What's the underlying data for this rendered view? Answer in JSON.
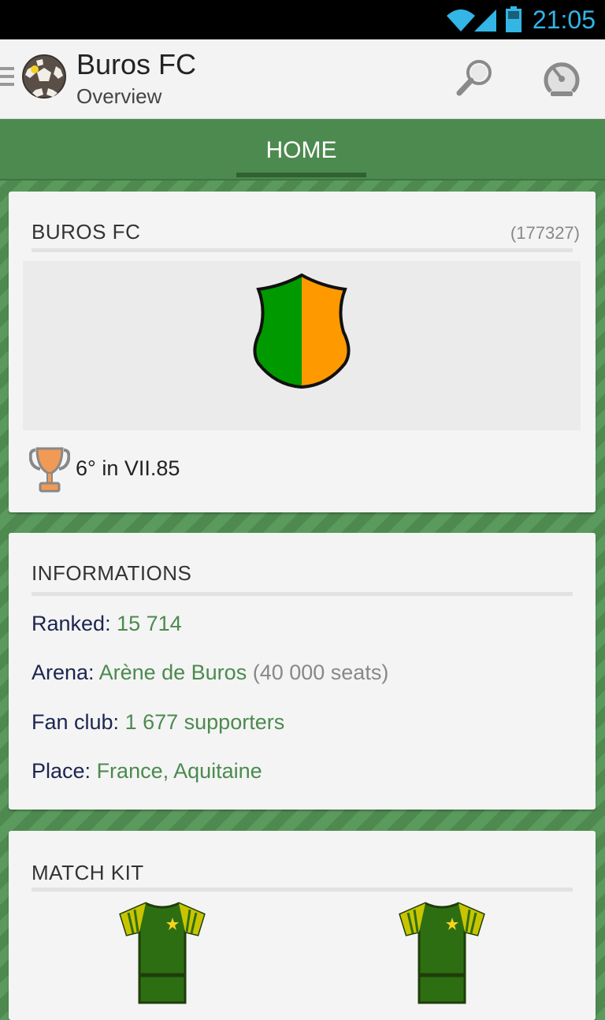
{
  "status_bar": {
    "time": "21:05",
    "icons": [
      "wifi-icon",
      "signal-icon",
      "battery-icon"
    ],
    "accent_color": "#33b5e5"
  },
  "action_bar": {
    "title": "Buros FC",
    "subtitle": "Overview",
    "icons": [
      "drawer-menu-icon",
      "club-logo-ball-icon",
      "search-icon",
      "speedometer-icon"
    ]
  },
  "tabs": [
    {
      "label": "HOME",
      "selected": true
    }
  ],
  "club_card": {
    "title": "BUROS FC",
    "id": "(177327)",
    "crest_colors": [
      "#009900",
      "#ff9900"
    ],
    "rank_text": "6° in VII.85"
  },
  "info_card": {
    "title": "INFORMATIONS",
    "rows": [
      {
        "label": "Ranked:",
        "value": "15 714",
        "extra": ""
      },
      {
        "label": "Arena:",
        "value": "Arène de Buros",
        "extra": "(40 000 seats)"
      },
      {
        "label": "Fan club:",
        "value": "1 677 supporters",
        "extra": ""
      },
      {
        "label": "Place:",
        "value": "France, Aquitaine",
        "extra": ""
      }
    ]
  },
  "kit_card": {
    "title": "MATCH KIT",
    "kits": [
      "home-kit",
      "away-kit"
    ],
    "kit_colors": {
      "shirt": "#2e6e12",
      "sleeves": "#d9d000",
      "star": "#f5d21f"
    }
  },
  "colors": {
    "brand_green": "#4d8a4f",
    "value_green": "#4b8a4e",
    "label_navy": "#1c2550"
  }
}
